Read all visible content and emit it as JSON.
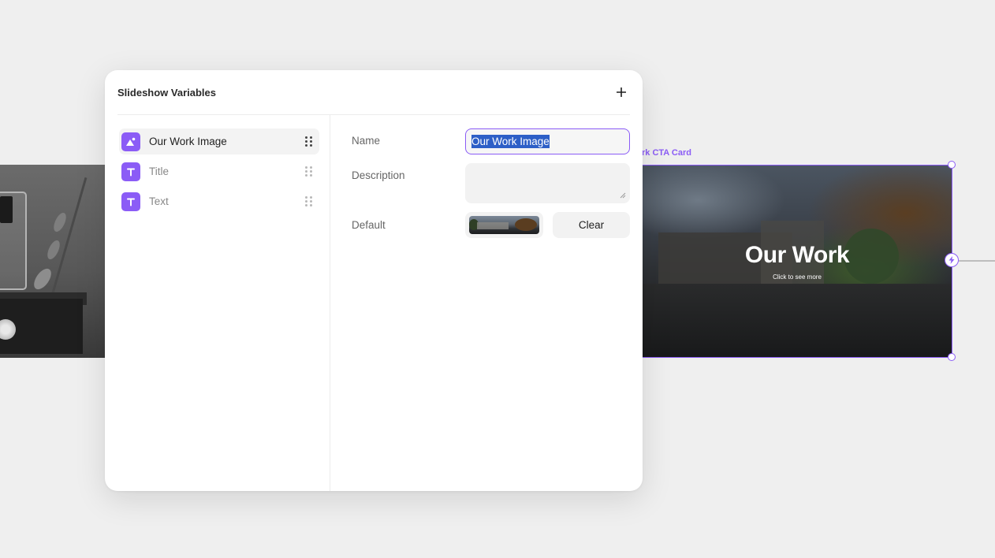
{
  "canvas": {
    "right_frame": {
      "label": "rk CTA Card",
      "title": "Our Work",
      "subtitle": "Click to see more"
    },
    "accent_color": "#8b5cf6"
  },
  "modal": {
    "title": "Slideshow Variables",
    "add_icon": "plus-icon",
    "variables": [
      {
        "label": "Our Work Image",
        "icon": "image-variable-icon",
        "active": true
      },
      {
        "label": "Title",
        "icon": "text-variable-icon",
        "active": false
      },
      {
        "label": "Text",
        "icon": "text-variable-icon",
        "active": false
      }
    ],
    "detail": {
      "name_label": "Name",
      "name_value": "Our Work Image",
      "description_label": "Description",
      "description_value": "",
      "default_label": "Default",
      "clear_label": "Clear"
    }
  }
}
